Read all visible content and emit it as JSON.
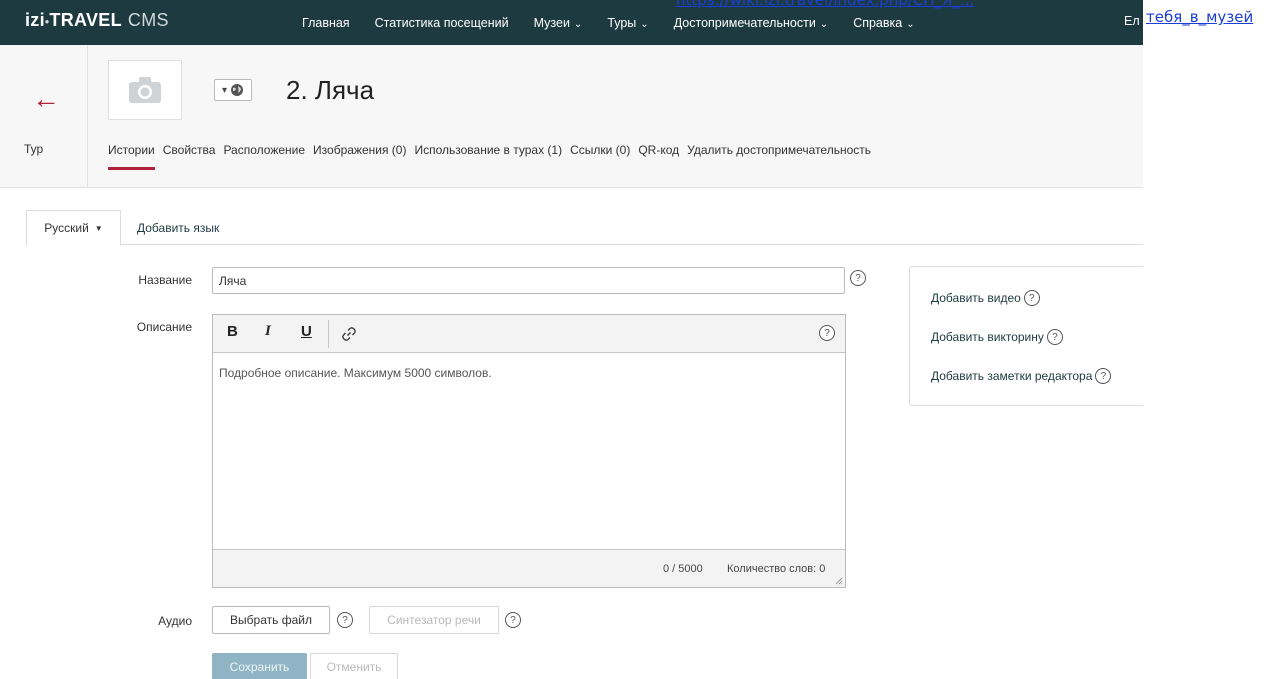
{
  "app": {
    "logo_main": "izi",
    "logo_dot": "•",
    "logo_travel": "TRAVEL",
    "logo_cms": "CMS"
  },
  "nav": {
    "items": [
      {
        "label": "Главная",
        "dropdown": false
      },
      {
        "label": "Статистика посещений",
        "dropdown": false
      },
      {
        "label": "Музеи",
        "dropdown": true
      },
      {
        "label": "Туры",
        "dropdown": true
      },
      {
        "label": "Достопримечательности",
        "dropdown": true
      },
      {
        "label": "Справка",
        "dropdown": true
      }
    ],
    "user_truncated": "Ел"
  },
  "overlay": {
    "url_top": "https://wiki.izi.travel/index.php/СП_Я_...",
    "url_right": "тебя_в_музей"
  },
  "header": {
    "back_label": "Тур",
    "title": "2. Ляча",
    "tabs": [
      {
        "label": "Истории",
        "active": true
      },
      {
        "label": "Свойства",
        "active": false
      },
      {
        "label": "Расположение",
        "active": false
      },
      {
        "label": "Изображения (0)",
        "active": false
      },
      {
        "label": "Использование в турах (1)",
        "active": false
      },
      {
        "label": "Ссылки (0)",
        "active": false
      },
      {
        "label": "QR-код",
        "active": false
      },
      {
        "label": "Удалить достопримечательность",
        "active": false
      }
    ]
  },
  "language": {
    "current": "Русский",
    "add_label": "Добавить язык"
  },
  "form": {
    "name_label": "Название",
    "name_value": "Ляча",
    "description_label": "Описание",
    "description_placeholder": "Подробное описание. Максимум 5000 символов.",
    "toolbar": {
      "bold": "B",
      "italic": "I",
      "underline": "U"
    },
    "char_count": "0 / 5000",
    "word_count": "Количество слов: 0",
    "audio_label": "Аудио",
    "choose_file": "Выбрать файл",
    "tts": "Синтезатор речи",
    "save": "Сохранить",
    "cancel": "Отменить"
  },
  "side": {
    "add_video": "Добавить видео",
    "add_quiz": "Добавить викторину",
    "add_notes": "Добавить заметки редактора"
  },
  "colors": {
    "topbar": "#1e3a41",
    "accent": "#b3223c",
    "primary_disabled": "#8fb5c4"
  }
}
